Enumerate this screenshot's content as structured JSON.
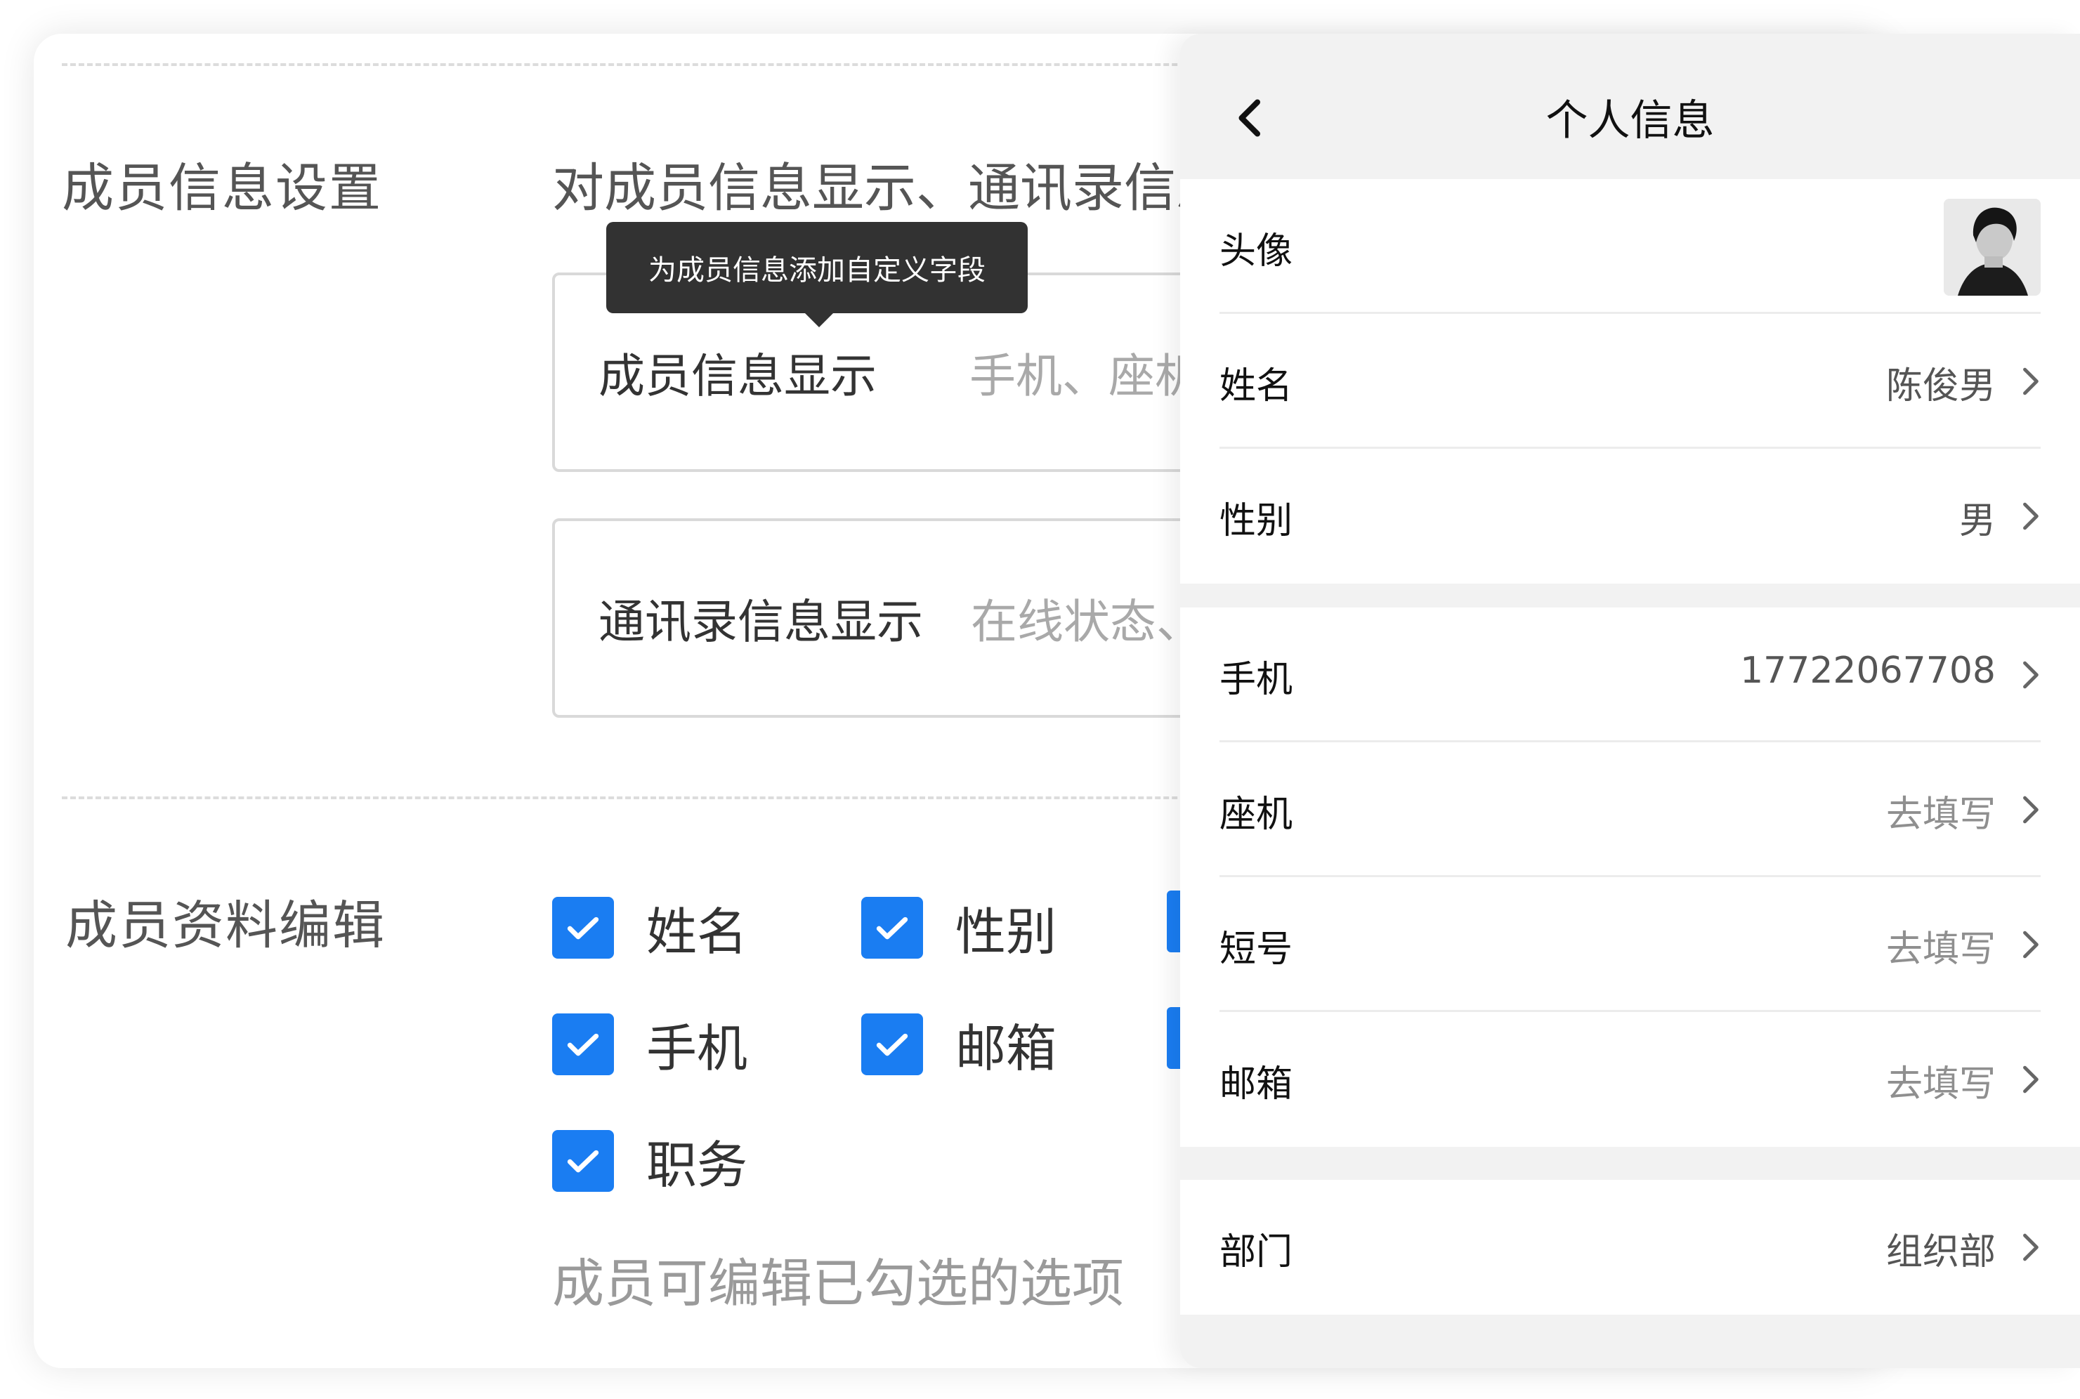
{
  "settings": {
    "member_info_settings_title": "成员信息设置",
    "member_info_settings_desc": "对成员信息显示、通讯录信息",
    "tooltip": "为成员信息添加自定义字段",
    "member_info_display_label": "成员信息显示",
    "member_info_display_value": "手机、座机",
    "contacts_info_display_label": "通讯录信息显示",
    "contacts_info_display_value": "在线状态、",
    "member_profile_edit_title": "成员资料编辑",
    "checkboxes": [
      {
        "label": "姓名",
        "checked": true
      },
      {
        "label": "性别",
        "checked": true
      },
      {
        "label": "手机",
        "checked": true
      },
      {
        "label": "邮箱",
        "checked": true
      },
      {
        "label": "职务",
        "checked": true
      }
    ],
    "edit_note": "成员可编辑已勾选的选项"
  },
  "profile": {
    "title": "个人信息",
    "rows": [
      {
        "key": "头像",
        "value": ""
      },
      {
        "key": "姓名",
        "value": "陈俊男"
      },
      {
        "key": "性别",
        "value": "男"
      },
      {
        "key": "手机",
        "value": "17722067708"
      },
      {
        "key": "座机",
        "value": "去填写"
      },
      {
        "key": "短号",
        "value": "去填写"
      },
      {
        "key": "邮箱",
        "value": "去填写"
      },
      {
        "key": "部门",
        "value": "组织部"
      }
    ]
  },
  "colors": {
    "accent": "#1a7df2",
    "tooltip_bg": "#323232",
    "panel_bg": "#f2f2f2"
  },
  "icons": [
    "back-chevron-icon",
    "checkmark-icon",
    "chevron-right-icon",
    "avatar-image"
  ]
}
